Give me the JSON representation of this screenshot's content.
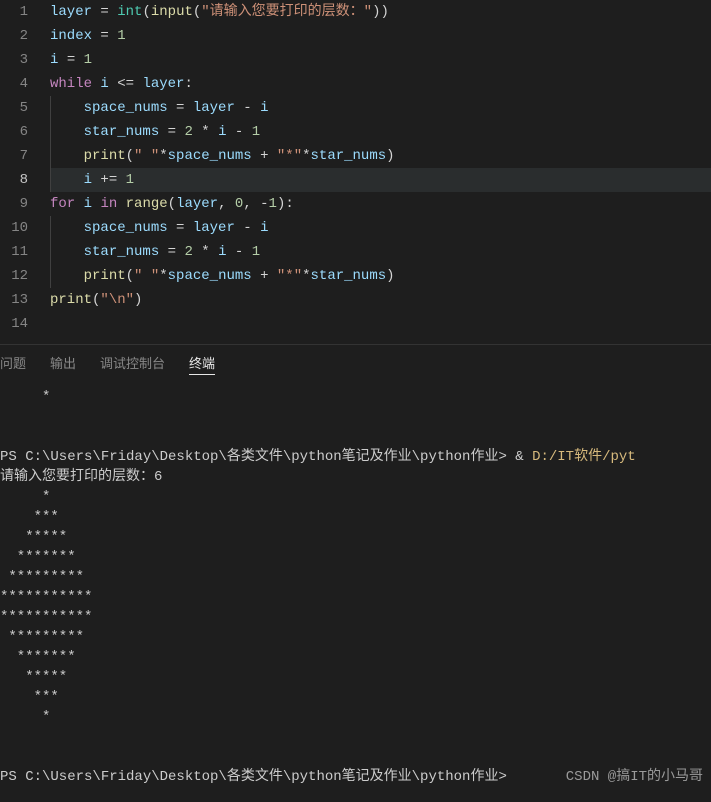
{
  "editor": {
    "activeLine": 8,
    "lines": [
      [
        {
          "t": "layer",
          "c": "v"
        },
        {
          "t": " ",
          "c": "op"
        },
        {
          "t": "=",
          "c": "op"
        },
        {
          "t": " ",
          "c": "op"
        },
        {
          "t": "int",
          "c": "bi"
        },
        {
          "t": "(",
          "c": "p"
        },
        {
          "t": "input",
          "c": "fn"
        },
        {
          "t": "(",
          "c": "p"
        },
        {
          "t": "\"请输入您要打印的层数：\"",
          "c": "s"
        },
        {
          "t": ")",
          "c": "p"
        },
        {
          "t": ")",
          "c": "p"
        }
      ],
      [
        {
          "t": "index",
          "c": "v"
        },
        {
          "t": " ",
          "c": "op"
        },
        {
          "t": "=",
          "c": "op"
        },
        {
          "t": " ",
          "c": "op"
        },
        {
          "t": "1",
          "c": "n"
        }
      ],
      [
        {
          "t": "i",
          "c": "v"
        },
        {
          "t": " ",
          "c": "op"
        },
        {
          "t": "=",
          "c": "op"
        },
        {
          "t": " ",
          "c": "op"
        },
        {
          "t": "1",
          "c": "n"
        }
      ],
      [
        {
          "t": "while",
          "c": "kw"
        },
        {
          "t": " ",
          "c": "op"
        },
        {
          "t": "i",
          "c": "v"
        },
        {
          "t": " ",
          "c": "op"
        },
        {
          "t": "<=",
          "c": "op"
        },
        {
          "t": " ",
          "c": "op"
        },
        {
          "t": "layer",
          "c": "v"
        },
        {
          "t": ":",
          "c": "p"
        }
      ],
      [
        {
          "t": "    ",
          "c": "op"
        },
        {
          "t": "space_nums",
          "c": "v"
        },
        {
          "t": " ",
          "c": "op"
        },
        {
          "t": "=",
          "c": "op"
        },
        {
          "t": " ",
          "c": "op"
        },
        {
          "t": "layer",
          "c": "v"
        },
        {
          "t": " ",
          "c": "op"
        },
        {
          "t": "-",
          "c": "op"
        },
        {
          "t": " ",
          "c": "op"
        },
        {
          "t": "i",
          "c": "v"
        }
      ],
      [
        {
          "t": "    ",
          "c": "op"
        },
        {
          "t": "star_nums",
          "c": "v"
        },
        {
          "t": " ",
          "c": "op"
        },
        {
          "t": "=",
          "c": "op"
        },
        {
          "t": " ",
          "c": "op"
        },
        {
          "t": "2",
          "c": "n"
        },
        {
          "t": " ",
          "c": "op"
        },
        {
          "t": "*",
          "c": "op"
        },
        {
          "t": " ",
          "c": "op"
        },
        {
          "t": "i",
          "c": "v"
        },
        {
          "t": " ",
          "c": "op"
        },
        {
          "t": "-",
          "c": "op"
        },
        {
          "t": " ",
          "c": "op"
        },
        {
          "t": "1",
          "c": "n"
        }
      ],
      [
        {
          "t": "    ",
          "c": "op"
        },
        {
          "t": "print",
          "c": "fn"
        },
        {
          "t": "(",
          "c": "p"
        },
        {
          "t": "\" \"",
          "c": "s"
        },
        {
          "t": "*",
          "c": "op"
        },
        {
          "t": "space_nums",
          "c": "v"
        },
        {
          "t": " ",
          "c": "op"
        },
        {
          "t": "+",
          "c": "op"
        },
        {
          "t": " ",
          "c": "op"
        },
        {
          "t": "\"*\"",
          "c": "s"
        },
        {
          "t": "*",
          "c": "op"
        },
        {
          "t": "star_nums",
          "c": "v"
        },
        {
          "t": ")",
          "c": "p"
        }
      ],
      [
        {
          "t": "    ",
          "c": "op"
        },
        {
          "t": "i",
          "c": "v"
        },
        {
          "t": " ",
          "c": "op"
        },
        {
          "t": "+=",
          "c": "op"
        },
        {
          "t": " ",
          "c": "op"
        },
        {
          "t": "1",
          "c": "n"
        }
      ],
      [
        {
          "t": "for",
          "c": "kw"
        },
        {
          "t": " ",
          "c": "op"
        },
        {
          "t": "i",
          "c": "v"
        },
        {
          "t": " ",
          "c": "op"
        },
        {
          "t": "in",
          "c": "kw"
        },
        {
          "t": " ",
          "c": "op"
        },
        {
          "t": "range",
          "c": "fn"
        },
        {
          "t": "(",
          "c": "p"
        },
        {
          "t": "layer",
          "c": "v"
        },
        {
          "t": ",",
          "c": "p"
        },
        {
          "t": " ",
          "c": "op"
        },
        {
          "t": "0",
          "c": "n"
        },
        {
          "t": ",",
          "c": "p"
        },
        {
          "t": " ",
          "c": "op"
        },
        {
          "t": "-",
          "c": "op"
        },
        {
          "t": "1",
          "c": "n"
        },
        {
          "t": ")",
          "c": "p"
        },
        {
          "t": ":",
          "c": "p"
        }
      ],
      [
        {
          "t": "    ",
          "c": "op"
        },
        {
          "t": "space_nums",
          "c": "v"
        },
        {
          "t": " ",
          "c": "op"
        },
        {
          "t": "=",
          "c": "op"
        },
        {
          "t": " ",
          "c": "op"
        },
        {
          "t": "layer",
          "c": "v"
        },
        {
          "t": " ",
          "c": "op"
        },
        {
          "t": "-",
          "c": "op"
        },
        {
          "t": " ",
          "c": "op"
        },
        {
          "t": "i",
          "c": "v"
        }
      ],
      [
        {
          "t": "    ",
          "c": "op"
        },
        {
          "t": "star_nums",
          "c": "v"
        },
        {
          "t": " ",
          "c": "op"
        },
        {
          "t": "=",
          "c": "op"
        },
        {
          "t": " ",
          "c": "op"
        },
        {
          "t": "2",
          "c": "n"
        },
        {
          "t": " ",
          "c": "op"
        },
        {
          "t": "*",
          "c": "op"
        },
        {
          "t": " ",
          "c": "op"
        },
        {
          "t": "i",
          "c": "v"
        },
        {
          "t": " ",
          "c": "op"
        },
        {
          "t": "-",
          "c": "op"
        },
        {
          "t": " ",
          "c": "op"
        },
        {
          "t": "1",
          "c": "n"
        }
      ],
      [
        {
          "t": "    ",
          "c": "op"
        },
        {
          "t": "print",
          "c": "fn"
        },
        {
          "t": "(",
          "c": "p"
        },
        {
          "t": "\" \"",
          "c": "s"
        },
        {
          "t": "*",
          "c": "op"
        },
        {
          "t": "space_nums",
          "c": "v"
        },
        {
          "t": " ",
          "c": "op"
        },
        {
          "t": "+",
          "c": "op"
        },
        {
          "t": " ",
          "c": "op"
        },
        {
          "t": "\"*\"",
          "c": "s"
        },
        {
          "t": "*",
          "c": "op"
        },
        {
          "t": "star_nums",
          "c": "v"
        },
        {
          "t": ")",
          "c": "p"
        }
      ],
      [
        {
          "t": "print",
          "c": "fn"
        },
        {
          "t": "(",
          "c": "p"
        },
        {
          "t": "\"\\n\"",
          "c": "s"
        },
        {
          "t": ")",
          "c": "p"
        }
      ],
      []
    ]
  },
  "tabs": {
    "problems": "问题",
    "output": "输出",
    "debugConsole": "调试控制台",
    "terminal": "终端"
  },
  "terminal": {
    "scroll1": "     *",
    "prompt1_path": "PS C:\\Users\\Friday\\Desktop\\各类文件\\python笔记及作业\\python作业> ",
    "prompt1_cmd_amp": "& ",
    "prompt1_cmd": "D:/IT软件/pyt",
    "inputLine": "请输入您要打印的层数：6",
    "output": [
      "     *",
      "    ***",
      "   *****",
      "  *******",
      " *********",
      "***********",
      "***********",
      " *********",
      "  *******",
      "   *****",
      "    ***",
      "     *",
      "",
      ""
    ],
    "prompt2_path": "PS C:\\Users\\Friday\\Desktop\\各类文件\\python笔记及作业\\python作业> ",
    "watermark": "CSDN @搞IT的小马哥"
  }
}
